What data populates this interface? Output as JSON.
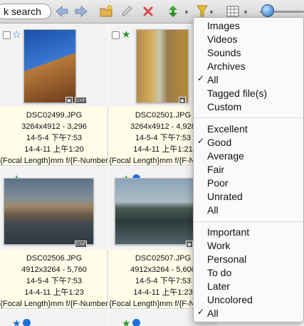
{
  "toolbar": {
    "search_text": "k search",
    "icons": [
      "back-arrow-icon",
      "forward-arrow-icon",
      "new-folder-icon",
      "edit-icon",
      "delete-icon",
      "refresh-icon",
      "filter-icon",
      "view-grid-icon",
      "zoom-slider"
    ],
    "colors": {
      "arrows": "#8ea3c7",
      "delete": "#d94b4b",
      "refresh": "#3aa62e",
      "filter": "#d8a11a"
    }
  },
  "files": [
    {
      "name": "DSC02499.JPG",
      "dimensions": "3264x4912 - 3,296",
      "modified": "14-5-4 下午7:53",
      "taken": "14-4-11 上午1:20",
      "exif": "{Focal Length}mm f/{F-Number",
      "rating_color": "#1e6fd9",
      "badge": "EXIF"
    },
    {
      "name": "DSC02501.JPG",
      "dimensions": "3264x4912 - 4,928",
      "modified": "14-5-4 下午7:53",
      "taken": "14-4-11 上午1:21",
      "exif": "{Focal Length}mm f/{F-Number",
      "rating_color": "#2a9a2a",
      "badge": "EXIF"
    },
    {
      "name": "DSC02506.JPG",
      "dimensions": "4912x3264 - 5,760",
      "modified": "14-5-4 下午7:53",
      "taken": "14-4-11 上午1:23",
      "exif": "{Focal Length}mm f/{F-Number",
      "rating_color": "#2a9a2a",
      "badge": "EXIF"
    },
    {
      "name": "DSC02507.JPG",
      "dimensions": "4912x3264 - 5,600",
      "modified": "14-5-4 下午7:53",
      "taken": "14-4-11 上午1:23",
      "exif": "{Focal Length}mm f/{F-Number",
      "rating_color": "#2a9a2a",
      "badge": "EXIF"
    }
  ],
  "menu": {
    "types": [
      "Images",
      "Videos",
      "Sounds",
      "Archives",
      "All",
      "Tagged file(s)",
      "Custom"
    ],
    "ratings": [
      "Excellent",
      "Good",
      "Average",
      "Fair",
      "Poor",
      "Unrated",
      "All"
    ],
    "labels": [
      "Important",
      "Work",
      "Personal",
      "To do",
      "Later",
      "Uncolored",
      "All"
    ],
    "checked": {
      "types": "All",
      "ratings": "Good",
      "labels": "All"
    },
    "check_mark": "✓"
  }
}
